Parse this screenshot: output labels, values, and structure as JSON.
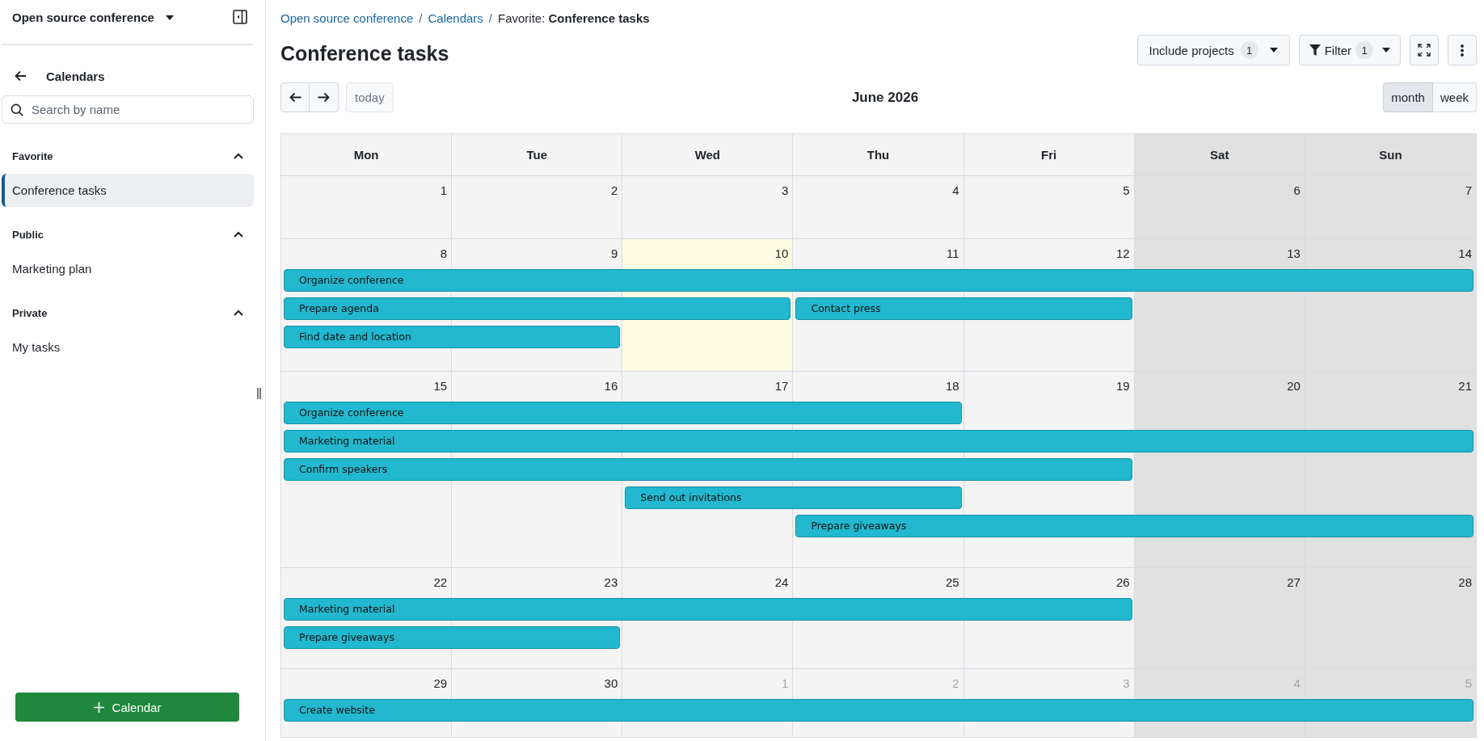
{
  "sidebar": {
    "project": "Open source conference",
    "heading": "Calendars",
    "search": {
      "placeholder": "Search by name"
    },
    "sections": [
      {
        "title": "Favorite",
        "expanded": true,
        "items": [
          {
            "label": "Conference tasks",
            "selected": true
          }
        ]
      },
      {
        "title": "Public",
        "expanded": true,
        "items": [
          {
            "label": "Marketing plan",
            "selected": false
          }
        ]
      },
      {
        "title": "Private",
        "expanded": true,
        "items": [
          {
            "label": "My tasks",
            "selected": false
          }
        ]
      }
    ],
    "add_button": "Calendar"
  },
  "breadcrumb": {
    "separator": "/",
    "links": [
      "Open source conference",
      "Calendars"
    ],
    "current": "Favorite: **Conference tasks**"
  },
  "page_title": "Conference tasks",
  "toolbar": [
    {
      "kind": "dropdown",
      "label": "Include projects",
      "badge": "1"
    },
    {
      "kind": "filter",
      "label": "Filter",
      "badge": "1"
    }
  ],
  "navigation": {
    "today": {
      "label": "today",
      "disabled": true
    },
    "period": "June 2026",
    "views": [
      {
        "label": "month",
        "selected": true
      },
      {
        "label": "week",
        "selected": false
      }
    ]
  },
  "calendar": {
    "weekdays": [
      {
        "label": "Mon",
        "weekend": false
      },
      {
        "label": "Tue",
        "weekend": false
      },
      {
        "label": "Wed",
        "weekend": false
      },
      {
        "label": "Thu",
        "weekend": false
      },
      {
        "label": "Fri",
        "weekend": false
      },
      {
        "label": "Sat",
        "weekend": true
      },
      {
        "label": "Sun",
        "weekend": true
      }
    ],
    "weeks": [
      {
        "days": [
          {
            "label": "1",
            "today": false,
            "other_month": false
          },
          {
            "label": "2",
            "today": false,
            "other_month": false
          },
          {
            "label": "3",
            "today": false,
            "other_month": false
          },
          {
            "label": "4",
            "today": false,
            "other_month": false
          },
          {
            "label": "5",
            "today": false,
            "other_month": false
          },
          {
            "label": "6",
            "today": false,
            "other_month": false
          },
          {
            "label": "7",
            "today": false,
            "other_month": false
          }
        ]
      },
      {
        "days": [
          {
            "label": "8",
            "today": false,
            "other_month": false
          },
          {
            "label": "9",
            "today": false,
            "other_month": false
          },
          {
            "label": "10",
            "today": true,
            "other_month": false
          },
          {
            "label": "11",
            "today": false,
            "other_month": false
          },
          {
            "label": "12",
            "today": false,
            "other_month": false
          },
          {
            "label": "13",
            "today": false,
            "other_month": false
          },
          {
            "label": "14",
            "today": false,
            "other_month": false
          }
        ],
        "lanes": [
          [
            {
              "kind": "start",
              "title": "Organize conference"
            },
            {
              "kind": "continue"
            },
            {
              "kind": "continue"
            },
            {
              "kind": "continue"
            },
            {
              "kind": "continue"
            },
            {
              "kind": "continue"
            },
            {
              "kind": "continue"
            }
          ],
          [
            {
              "kind": "start",
              "title": "Prepare agenda"
            },
            {
              "kind": "continue"
            },
            {
              "kind": "continue"
            },
            {
              "kind": "start",
              "title": "Contact press"
            },
            {
              "kind": "continue"
            },
            {
              "kind": "empty"
            },
            {
              "kind": "empty"
            }
          ],
          [
            {
              "kind": "start",
              "title": "Find date and location"
            },
            {
              "kind": "continue"
            },
            {
              "kind": "empty"
            },
            {
              "kind": "empty"
            },
            {
              "kind": "empty"
            },
            {
              "kind": "empty"
            },
            {
              "kind": "empty"
            }
          ]
        ]
      },
      {
        "days": [
          {
            "label": "15",
            "today": false,
            "other_month": false
          },
          {
            "label": "16",
            "today": false,
            "other_month": false
          },
          {
            "label": "17",
            "today": false,
            "other_month": false
          },
          {
            "label": "18",
            "today": false,
            "other_month": false
          },
          {
            "label": "19",
            "today": false,
            "other_month": false
          },
          {
            "label": "20",
            "today": false,
            "other_month": false
          },
          {
            "label": "21",
            "today": false,
            "other_month": false
          }
        ],
        "lanes": [
          [
            {
              "kind": "start",
              "title": "Organize conference"
            },
            {
              "kind": "continue"
            },
            {
              "kind": "continue"
            },
            {
              "kind": "continue"
            },
            {
              "kind": "empty"
            },
            {
              "kind": "empty"
            },
            {
              "kind": "empty"
            }
          ],
          [
            {
              "kind": "start",
              "title": "Marketing material"
            },
            {
              "kind": "continue"
            },
            {
              "kind": "continue"
            },
            {
              "kind": "continue"
            },
            {
              "kind": "continue"
            },
            {
              "kind": "continue"
            },
            {
              "kind": "continue"
            }
          ],
          [
            {
              "kind": "start",
              "title": "Confirm speakers"
            },
            {
              "kind": "continue"
            },
            {
              "kind": "continue"
            },
            {
              "kind": "continue"
            },
            {
              "kind": "continue"
            },
            {
              "kind": "empty"
            },
            {
              "kind": "empty"
            }
          ],
          [
            {
              "kind": "empty"
            },
            {
              "kind": "empty"
            },
            {
              "kind": "start",
              "title": "Send out invitations"
            },
            {
              "kind": "continue"
            },
            {
              "kind": "empty"
            },
            {
              "kind": "empty"
            },
            {
              "kind": "empty"
            }
          ],
          [
            {
              "kind": "empty"
            },
            {
              "kind": "empty"
            },
            {
              "kind": "empty"
            },
            {
              "kind": "start",
              "title": "Prepare giveaways"
            },
            {
              "kind": "continue"
            },
            {
              "kind": "continue"
            },
            {
              "kind": "continue"
            }
          ]
        ]
      },
      {
        "days": [
          {
            "label": "22",
            "today": false,
            "other_month": false
          },
          {
            "label": "23",
            "today": false,
            "other_month": false
          },
          {
            "label": "24",
            "today": false,
            "other_month": false
          },
          {
            "label": "25",
            "today": false,
            "other_month": false
          },
          {
            "label": "26",
            "today": false,
            "other_month": false
          },
          {
            "label": "27",
            "today": false,
            "other_month": false
          },
          {
            "label": "28",
            "today": false,
            "other_month": false
          }
        ],
        "lanes": [
          [
            {
              "kind": "start",
              "title": "Marketing material"
            },
            {
              "kind": "continue"
            },
            {
              "kind": "continue"
            },
            {
              "kind": "continue"
            },
            {
              "kind": "continue"
            },
            {
              "kind": "empty"
            },
            {
              "kind": "empty"
            }
          ],
          [
            {
              "kind": "start",
              "title": "Prepare giveaways"
            },
            {
              "kind": "continue"
            },
            {
              "kind": "empty"
            },
            {
              "kind": "empty"
            },
            {
              "kind": "empty"
            },
            {
              "kind": "empty"
            },
            {
              "kind": "empty"
            }
          ]
        ]
      },
      {
        "days": [
          {
            "label": "29",
            "today": false,
            "other_month": false
          },
          {
            "label": "30",
            "today": false,
            "other_month": false
          },
          {
            "label": "1",
            "today": false,
            "other_month": true
          },
          {
            "label": "2",
            "today": false,
            "other_month": true
          },
          {
            "label": "3",
            "today": false,
            "other_month": true
          },
          {
            "label": "4",
            "today": false,
            "other_month": true
          },
          {
            "label": "5",
            "today": false,
            "other_month": true
          }
        ],
        "lanes": [
          [
            {
              "kind": "start",
              "title": "Create website"
            },
            {
              "kind": "continue"
            },
            {
              "kind": "continue"
            },
            {
              "kind": "continue"
            },
            {
              "kind": "continue"
            },
            {
              "kind": "continue"
            },
            {
              "kind": "continue"
            }
          ]
        ]
      }
    ]
  }
}
